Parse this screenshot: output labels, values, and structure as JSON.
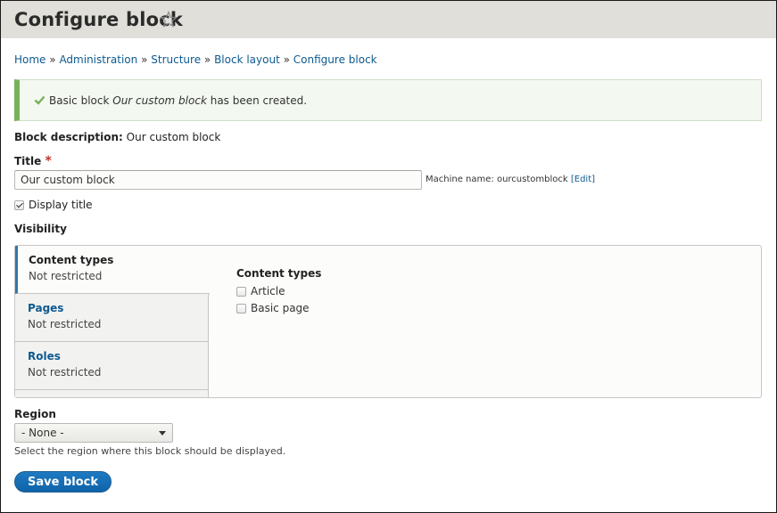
{
  "header": {
    "title": "Configure block",
    "shortcut_icon": "star-outline-icon"
  },
  "breadcrumb": [
    {
      "label": "Home"
    },
    {
      "label": "Administration"
    },
    {
      "label": "Structure"
    },
    {
      "label": "Block layout"
    },
    {
      "label": "Configure block"
    }
  ],
  "breadcrumb_separator": "»",
  "status": {
    "icon": "check-icon",
    "prefix": "Basic block ",
    "emphasis": "Our custom block",
    "suffix": " has been created.",
    "color": "#77b259"
  },
  "block_description": {
    "label": "Block description:",
    "value": " Our custom block"
  },
  "title_field": {
    "label": "Title",
    "required_mark": "*",
    "value": "Our custom block",
    "machine_name_label": "Machine name: ourcustomblock ",
    "machine_name_edit": "[Edit]"
  },
  "display_title": {
    "label": "Display title",
    "checked": true
  },
  "visibility": {
    "label": "Visibility",
    "tabs": [
      {
        "title": "Content types",
        "summary": "Not restricted",
        "active": true
      },
      {
        "title": "Pages",
        "summary": "Not restricted",
        "active": false
      },
      {
        "title": "Roles",
        "summary": "Not restricted",
        "active": false
      }
    ],
    "pane": {
      "heading": "Content types",
      "options": [
        {
          "label": "Article",
          "checked": false
        },
        {
          "label": "Basic page",
          "checked": false
        }
      ]
    }
  },
  "region": {
    "label": "Region",
    "selected": "- None -",
    "help": "Select the region where this block should be displayed."
  },
  "actions": {
    "save_label": "Save block",
    "accent": "#0f64a8"
  }
}
